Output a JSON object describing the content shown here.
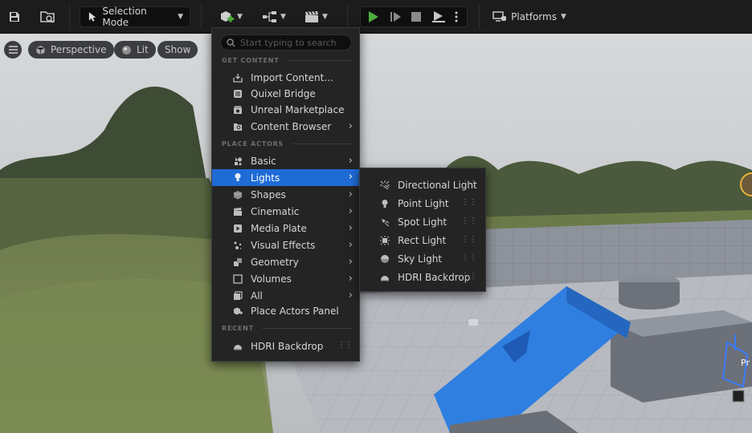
{
  "toolbar": {
    "selection_mode_label": "Selection Mode",
    "platforms_label": "Platforms"
  },
  "viewport": {
    "perspective_label": "Perspective",
    "lit_label": "Lit",
    "show_label": "Show",
    "actor_label": "Pr"
  },
  "menu": {
    "search_placeholder": "Start typing to search",
    "sections": {
      "get_content": "GET CONTENT",
      "place_actors": "PLACE ACTORS",
      "recent": "RECENT"
    },
    "get_content_items": [
      {
        "label": "Import Content...",
        "icon": "import-icon"
      },
      {
        "label": "Quixel Bridge",
        "icon": "bridge-icon"
      },
      {
        "label": "Unreal Marketplace",
        "icon": "marketplace-icon"
      },
      {
        "label": "Content Browser",
        "icon": "content-browser-icon",
        "submenu": true
      }
    ],
    "place_actor_items": [
      {
        "label": "Basic",
        "icon": "basic-icon",
        "submenu": true
      },
      {
        "label": "Lights",
        "icon": "light-bulb-icon",
        "submenu": true,
        "active": true
      },
      {
        "label": "Shapes",
        "icon": "cube-icon",
        "submenu": true
      },
      {
        "label": "Cinematic",
        "icon": "clapper-icon",
        "submenu": true
      },
      {
        "label": "Media Plate",
        "icon": "media-plate-icon",
        "submenu": true
      },
      {
        "label": "Visual Effects",
        "icon": "sparkle-icon",
        "submenu": true
      },
      {
        "label": "Geometry",
        "icon": "geometry-icon",
        "submenu": true
      },
      {
        "label": "Volumes",
        "icon": "volume-icon",
        "submenu": true
      },
      {
        "label": "All",
        "icon": "all-icon",
        "submenu": true
      },
      {
        "label": "Place Actors Panel",
        "icon": "place-actors-icon"
      }
    ],
    "recent_items": [
      {
        "label": "HDRI Backdrop",
        "icon": "hdri-icon"
      }
    ]
  },
  "lights_submenu": [
    {
      "label": "Directional Light",
      "icon": "directional-light-icon"
    },
    {
      "label": "Point Light",
      "icon": "point-light-icon"
    },
    {
      "label": "Spot Light",
      "icon": "spot-light-icon"
    },
    {
      "label": "Rect Light",
      "icon": "rect-light-icon"
    },
    {
      "label": "Sky Light",
      "icon": "sky-light-icon"
    },
    {
      "label": "HDRI Backdrop",
      "icon": "hdri-icon"
    }
  ],
  "colors": {
    "accent": "#1f6bd6",
    "play_green": "#4caf3a",
    "panel_bg": "#242424",
    "toolbar_bg": "#1c1c1c",
    "ramp_blue": "#2f7fe0"
  }
}
